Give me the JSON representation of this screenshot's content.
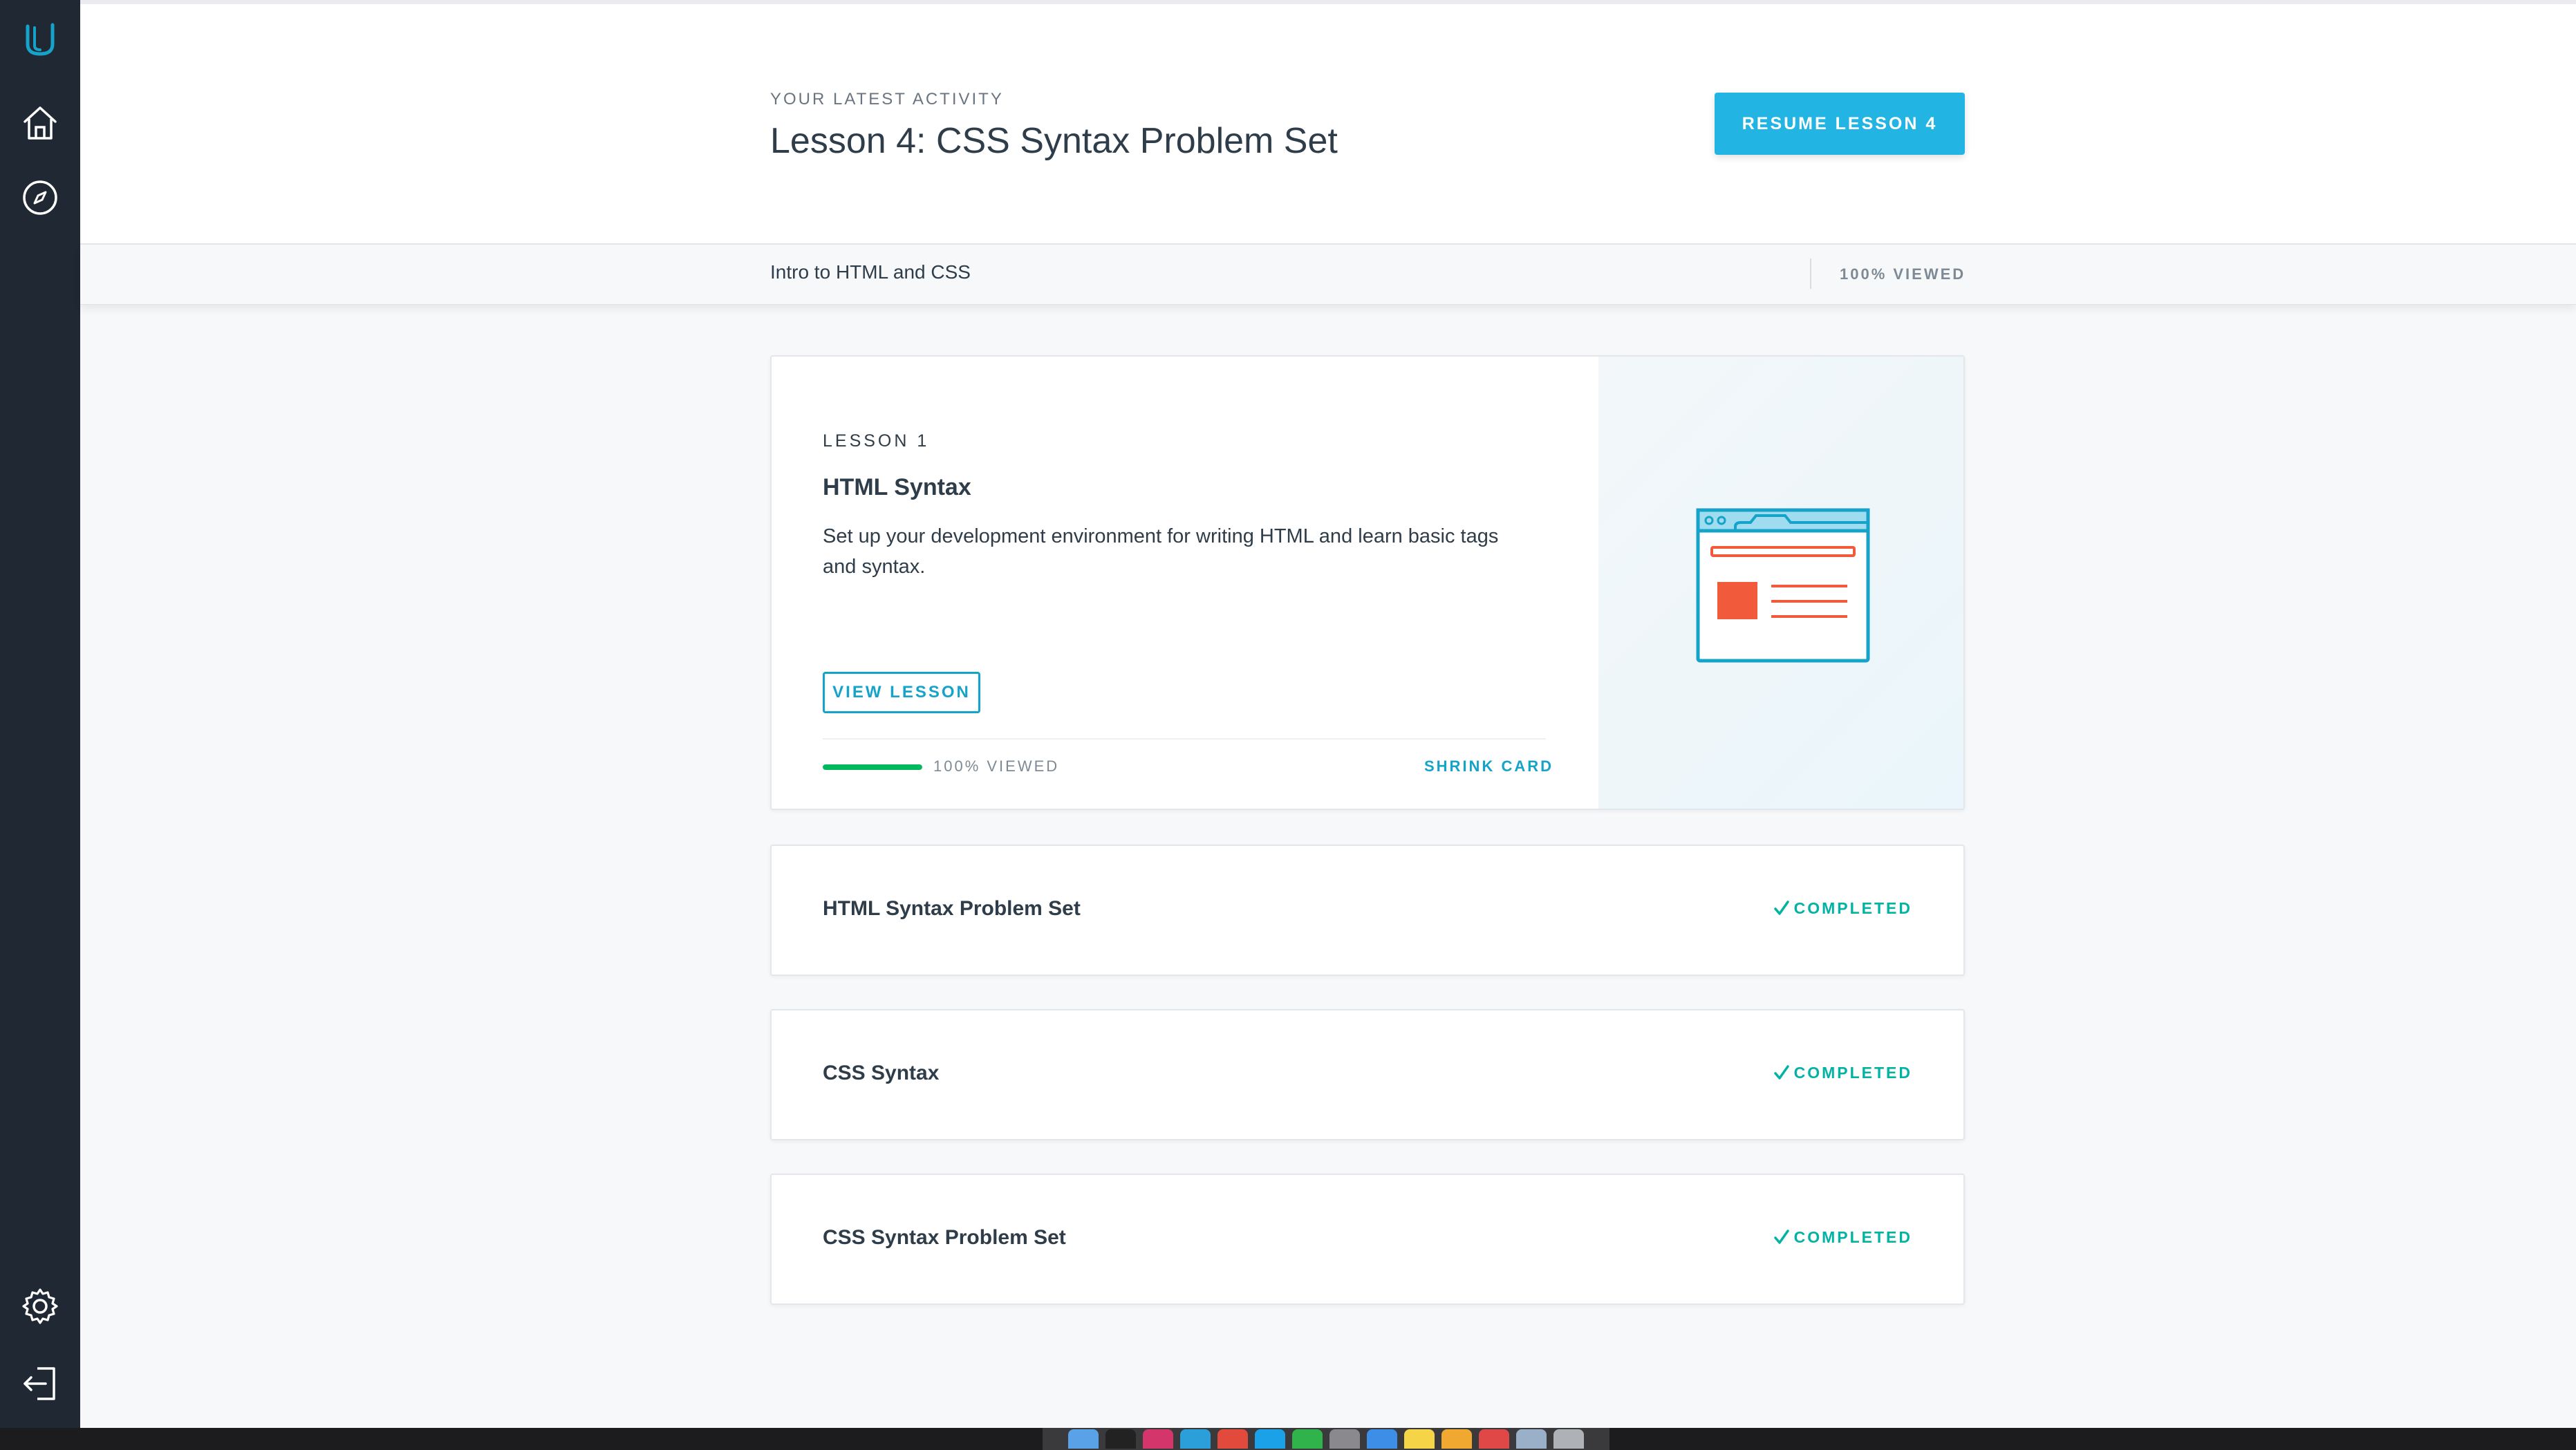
{
  "sidebar": {
    "icons": [
      {
        "name": "udacity-logo-icon"
      },
      {
        "name": "home-icon"
      },
      {
        "name": "compass-icon"
      },
      {
        "name": "settings-icon"
      },
      {
        "name": "logout-icon"
      }
    ]
  },
  "header": {
    "latest_label": "YOUR LATEST ACTIVITY",
    "latest_title": "Lesson 4: CSS Syntax Problem Set",
    "resume_label": "RESUME LESSON 4"
  },
  "subbar": {
    "course_name": "Intro to HTML and CSS",
    "viewed_label": "100% VIEWED"
  },
  "lesson_card": {
    "lesson_number": "LESSON 1",
    "title": "HTML Syntax",
    "description": "Set up your development environment for writing HTML and learn basic tags and syntax.",
    "view_button": "VIEW LESSON",
    "progress_fraction": 1.0,
    "progress_label": "100% VIEWED",
    "shrink_label": "SHRINK CARD"
  },
  "lessons": [
    {
      "title": "HTML Syntax Problem Set",
      "status": "COMPLETED"
    },
    {
      "title": "CSS Syntax",
      "status": "COMPLETED"
    },
    {
      "title": "CSS Syntax Problem Set",
      "status": "COMPLETED"
    }
  ],
  "colors": {
    "sidebar_bg": "#1f2833",
    "accent": "#22b5e3",
    "accent_dark": "#16a3c9",
    "success": "#02b3a4",
    "progress": "#02b85c",
    "illustration_red": "#f15a3b"
  }
}
